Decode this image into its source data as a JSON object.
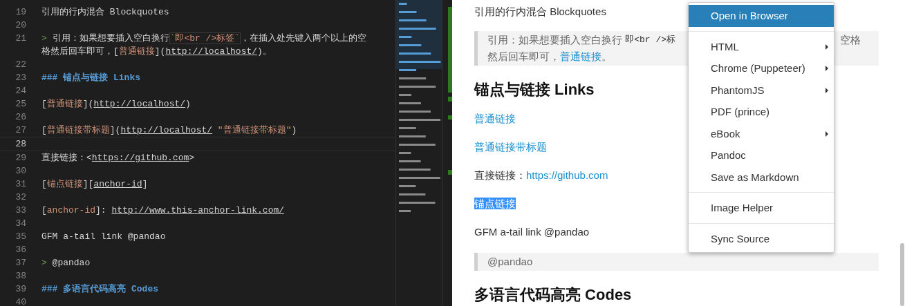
{
  "editor": {
    "lines": [
      {
        "number": "19",
        "current": false,
        "segments": [
          {
            "kind": "plain",
            "text": "引用的行内混合 Blockquotes"
          }
        ]
      },
      {
        "number": "20",
        "current": false
      },
      {
        "number": "21",
        "current": false,
        "segments": [
          {
            "kind": "quote",
            "text": "> "
          },
          {
            "kind": "plain",
            "text": "引用：如果想要插入空白换行"
          },
          {
            "kind": "code",
            "text": "`即<br />标签`"
          },
          {
            "kind": "plain",
            "text": "，在插入处先键入两个以上的空"
          },
          {
            "kind": "wrapped",
            "text": "格然后回车即可，["
          },
          {
            "kind": "link",
            "text": "普通链接"
          },
          {
            "kind": "plain",
            "text": "]("
          },
          {
            "kind": "url",
            "text": "http://localhost/"
          },
          {
            "kind": "plain",
            "text": ")。"
          }
        ]
      },
      {
        "number": "22",
        "current": false
      },
      {
        "number": "23",
        "current": false,
        "segments": [
          {
            "kind": "heading",
            "text": "### 锚点与链接 Links"
          }
        ]
      },
      {
        "number": "24",
        "current": false
      },
      {
        "number": "25",
        "current": false,
        "segments": [
          {
            "kind": "plain",
            "text": "["
          },
          {
            "kind": "link",
            "text": "普通链接"
          },
          {
            "kind": "plain",
            "text": "]("
          },
          {
            "kind": "url",
            "text": "http://localhost/"
          },
          {
            "kind": "plain",
            "text": ")"
          }
        ]
      },
      {
        "number": "26",
        "current": false
      },
      {
        "number": "27",
        "current": false,
        "segments": [
          {
            "kind": "plain",
            "text": "["
          },
          {
            "kind": "link",
            "text": "普通链接带标题"
          },
          {
            "kind": "plain",
            "text": "]("
          },
          {
            "kind": "url",
            "text": "http://localhost/"
          },
          {
            "kind": "link",
            "text": " \"普通链接带标题\""
          },
          {
            "kind": "plain",
            "text": ")"
          }
        ]
      },
      {
        "number": "28",
        "current": true
      },
      {
        "number": "29",
        "current": false,
        "segments": [
          {
            "kind": "plain",
            "text": "直接链接：<"
          },
          {
            "kind": "url",
            "text": "https://github.com"
          },
          {
            "kind": "plain",
            "text": ">"
          }
        ]
      },
      {
        "number": "30",
        "current": false
      },
      {
        "number": "31",
        "current": false,
        "segments": [
          {
            "kind": "plain",
            "text": "["
          },
          {
            "kind": "link",
            "text": "锚点链接"
          },
          {
            "kind": "plain",
            "text": "]["
          },
          {
            "kind": "url",
            "text": "anchor-id"
          },
          {
            "kind": "plain",
            "text": "]"
          }
        ]
      },
      {
        "number": "32",
        "current": false
      },
      {
        "number": "33",
        "current": false,
        "segments": [
          {
            "kind": "plain",
            "text": "["
          },
          {
            "kind": "link",
            "text": "anchor-id"
          },
          {
            "kind": "plain",
            "text": "]: "
          },
          {
            "kind": "url",
            "text": "http://www.this-anchor-link.com/"
          }
        ]
      },
      {
        "number": "34",
        "current": false
      },
      {
        "number": "35",
        "current": false,
        "segments": [
          {
            "kind": "plain",
            "text": "GFM a-tail link @pandao"
          }
        ]
      },
      {
        "number": "36",
        "current": false
      },
      {
        "number": "37",
        "current": false,
        "segments": [
          {
            "kind": "quote",
            "text": "> "
          },
          {
            "kind": "plain",
            "text": "@pandao"
          }
        ]
      },
      {
        "number": "38",
        "current": false
      },
      {
        "number": "39",
        "current": false,
        "segments": [
          {
            "kind": "heading",
            "text": "### 多语言代码高亮 Codes"
          }
        ]
      },
      {
        "number": "40",
        "current": false
      }
    ]
  },
  "preview": {
    "blocks": [
      {
        "kind": "paragraph",
        "segments": [
          {
            "kind": "text",
            "text": "引用的行内混合 Blockquotes"
          }
        ]
      },
      {
        "kind": "blockquote",
        "segments": [
          {
            "kind": "text",
            "text": "引用：如果想要插入空白换行 "
          },
          {
            "kind": "code",
            "text": "即<br />标"
          },
          {
            "kind": "trailing",
            "text": "空格"
          },
          {
            "kind": "wrapped",
            "text": "然后回车即可，"
          },
          {
            "kind": "link",
            "text": "普通链接",
            "highlighted": false
          },
          {
            "kind": "text",
            "text": "。"
          }
        ]
      },
      {
        "kind": "heading",
        "segments": [
          {
            "kind": "text",
            "text": "锚点与链接 Links"
          }
        ]
      },
      {
        "kind": "paragraph",
        "segments": [
          {
            "kind": "link",
            "text": "普通链接",
            "highlighted": false
          }
        ]
      },
      {
        "kind": "paragraph",
        "segments": [
          {
            "kind": "link",
            "text": "普通链接带标题",
            "highlighted": false
          }
        ]
      },
      {
        "kind": "paragraph",
        "segments": [
          {
            "kind": "text",
            "text": "直接链接："
          },
          {
            "kind": "link",
            "text": "https://github.com",
            "highlighted": false
          }
        ]
      },
      {
        "kind": "paragraph",
        "segments": [
          {
            "kind": "link",
            "text": "锚点链接",
            "highlighted": true
          }
        ]
      },
      {
        "kind": "paragraph",
        "segments": [
          {
            "kind": "text",
            "text": "GFM a-tail link @pandao"
          }
        ]
      },
      {
        "kind": "blockquote",
        "segments": [
          {
            "kind": "text",
            "text": "@pandao"
          }
        ]
      },
      {
        "kind": "heading",
        "segments": [
          {
            "kind": "text",
            "text": "多语言代码高亮 Codes"
          }
        ]
      }
    ]
  },
  "context_menu": {
    "items": [
      {
        "kind": "item",
        "label": "Open in Browser",
        "selected": true,
        "submenu": false
      },
      {
        "kind": "separator"
      },
      {
        "kind": "item",
        "label": "HTML",
        "selected": false,
        "submenu": true
      },
      {
        "kind": "item",
        "label": "Chrome (Puppeteer)",
        "selected": false,
        "submenu": true
      },
      {
        "kind": "item",
        "label": "PhantomJS",
        "selected": false,
        "submenu": true
      },
      {
        "kind": "item",
        "label": "PDF (prince)",
        "selected": false,
        "submenu": false
      },
      {
        "kind": "item",
        "label": "eBook",
        "selected": false,
        "submenu": true
      },
      {
        "kind": "item",
        "label": "Pandoc",
        "selected": false,
        "submenu": false
      },
      {
        "kind": "item",
        "label": "Save as Markdown",
        "selected": false,
        "submenu": false
      },
      {
        "kind": "separator"
      },
      {
        "kind": "item",
        "label": "Image Helper",
        "selected": false,
        "submenu": false
      },
      {
        "kind": "separator"
      },
      {
        "kind": "item",
        "label": "Sync Source",
        "selected": false,
        "submenu": false
      }
    ]
  }
}
